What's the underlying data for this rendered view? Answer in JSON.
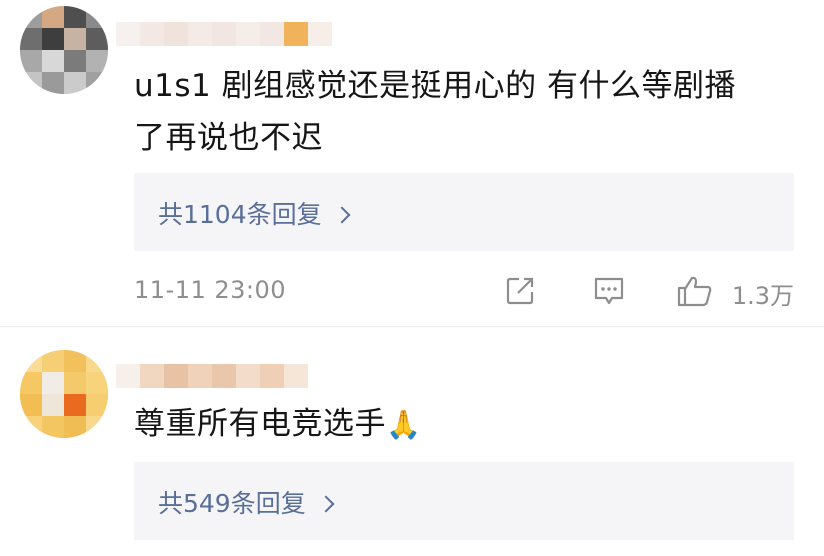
{
  "comments": [
    {
      "text_line1": "u1s1 剧组感觉还是挺用心的 有什么等剧播",
      "text_line2": "了再说也不迟",
      "replies_label": "共1104条回复",
      "time": "11-11 23:00",
      "likes": "1.3万",
      "icons": [
        "share-icon",
        "comment-icon",
        "like-icon"
      ]
    },
    {
      "text_line1": "尊重所有电竞选手",
      "emoji": "🙏",
      "replies_label": "共549条回复"
    }
  ],
  "colors": {
    "link": "#5a6f97",
    "meta_gray": "#8e8e8e",
    "reply_bg": "#f5f5f7"
  }
}
